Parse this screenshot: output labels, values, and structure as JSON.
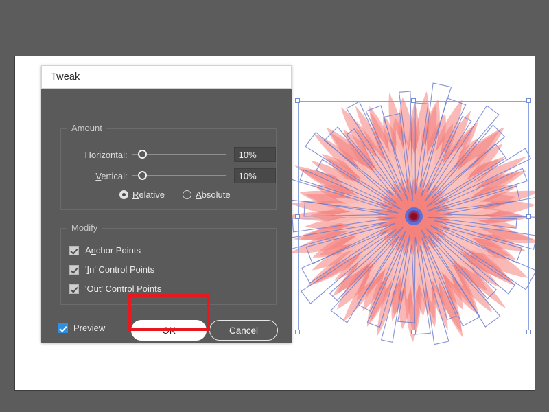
{
  "window": {
    "background_color": "#5c5c5c",
    "canvas_color": "#ffffff"
  },
  "dialog": {
    "title": "Tweak",
    "groups": {
      "amount": {
        "legend": "Amount",
        "rows": [
          {
            "label": "Horizontal:",
            "mnemonic": "H",
            "value": "10%",
            "slider_position_pct": 10
          },
          {
            "label": "Vertical:",
            "mnemonic": "V",
            "value": "10%",
            "slider_position_pct": 10
          }
        ],
        "mode_options": [
          {
            "label": "Relative",
            "mnemonic": "R",
            "selected": true
          },
          {
            "label": "Absolute",
            "mnemonic": "A",
            "selected": false
          }
        ]
      },
      "modify": {
        "legend": "Modify",
        "checkboxes": [
          {
            "label": "Anchor Points",
            "mnemonic": "n",
            "checked": true
          },
          {
            "label": "'In' Control Points",
            "mnemonic": "I",
            "checked": true
          },
          {
            "label": "'Out' Control Points",
            "mnemonic": "O",
            "checked": true
          }
        ]
      }
    },
    "footer": {
      "preview": {
        "label": "Preview",
        "mnemonic": "P",
        "checked": true,
        "color": "#2f8fe0"
      },
      "ok_label": "OK",
      "cancel_label": "Cancel"
    }
  },
  "annotation": {
    "highlight_color": "#e8191e",
    "target": "OK"
  },
  "artwork": {
    "description": "spiked flower burst",
    "petal_color": "#f4827d",
    "petal_color_light": "#fbc3bf",
    "path_stroke_color": "#6f7fd0",
    "center_core_color": "#a81028",
    "center_ring_color": "#4a5fd0",
    "selection": {
      "border_color": "#8ba4dd",
      "handle_fill": "#ffffff",
      "handle_border": "#6f8ed4"
    }
  }
}
